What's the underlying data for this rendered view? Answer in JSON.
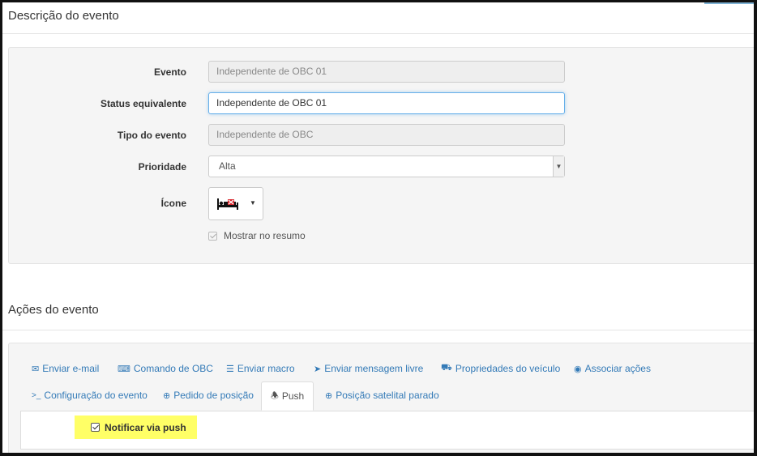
{
  "descricao": {
    "title": "Descrição do evento",
    "fields": {
      "evento": {
        "label": "Evento",
        "value": "Independente de OBC 01"
      },
      "status": {
        "label": "Status equivalente",
        "value": "Independente de OBC 01"
      },
      "tipo": {
        "label": "Tipo do evento",
        "value": "Independente de OBC"
      },
      "prioridade": {
        "label": "Prioridade",
        "value": "Alta"
      },
      "icone": {
        "label": "Ícone",
        "icon": "bed-icon"
      }
    },
    "mostrar_resumo": {
      "label": "Mostrar no resumo",
      "checked": true
    }
  },
  "acoes": {
    "title": "Ações do evento",
    "tabs_row1": [
      {
        "label": "Enviar e-mail",
        "icon": "envelope-icon"
      },
      {
        "label": "Comando de OBC",
        "icon": "keyboard-icon"
      },
      {
        "label": "Enviar macro",
        "icon": "list-icon"
      },
      {
        "label": "Enviar mensagem livre",
        "icon": "send-icon"
      },
      {
        "label": "Propriedades do veículo",
        "icon": "truck-icon"
      },
      {
        "label": "Associar ações",
        "icon": "circle-dot-icon"
      }
    ],
    "tabs_row2": [
      {
        "label": "Configuração do evento",
        "icon": "terminal-icon"
      },
      {
        "label": "Pedido de posição",
        "icon": "plus-circle-icon"
      },
      {
        "label": "Push",
        "icon": "bell-icon",
        "active": true
      },
      {
        "label": "Posição satelital parado",
        "icon": "plus-circle-icon"
      }
    ],
    "push": {
      "label": "Notificar via push",
      "checked": true
    }
  },
  "colors": {
    "link": "#337ab7",
    "highlight": "#ffff66",
    "focus_border": "#66afe9"
  }
}
